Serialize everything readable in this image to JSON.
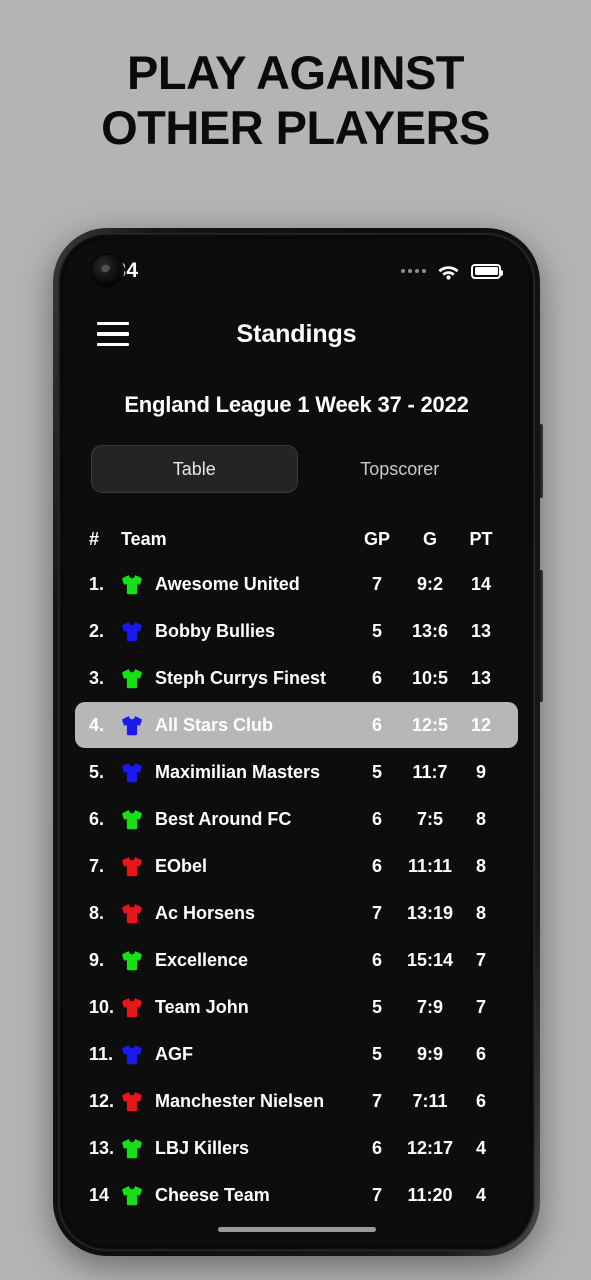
{
  "promo": {
    "headline_lines": [
      "PLAY AGAINST",
      "OTHER PLAYERS"
    ]
  },
  "status_bar": {
    "time": "9.34",
    "signal_icon": "signal-dots-icon",
    "wifi_icon": "wifi-icon",
    "battery_icon": "battery-full-icon"
  },
  "app_bar": {
    "menu_icon": "hamburger-menu-icon",
    "title": "Standings"
  },
  "league": {
    "title": "England League 1 Week 37 - 2022"
  },
  "tabs": [
    {
      "label": "Table",
      "active": true
    },
    {
      "label": "Topscorer",
      "active": false
    }
  ],
  "table": {
    "headers": {
      "rank": "#",
      "team": "Team",
      "gp": "GP",
      "g": "G",
      "pt": "PT"
    },
    "colors": {
      "green": "#16e016",
      "blue": "#1a19f0",
      "red": "#e8151a",
      "highlight_bg": "#b7b7b7",
      "screen_bg": "#0d0d0d",
      "text": "#ffffff"
    },
    "rows": [
      {
        "rank": "1.",
        "shirt": "green",
        "team": "Awesome United",
        "gp": "7",
        "g": "9:2",
        "pt": "14",
        "highlighted": false
      },
      {
        "rank": "2.",
        "shirt": "blue",
        "team": "Bobby Bullies",
        "gp": "5",
        "g": "13:6",
        "pt": "13",
        "highlighted": false
      },
      {
        "rank": "3.",
        "shirt": "green",
        "team": "Steph Currys Finest",
        "gp": "6",
        "g": "10:5",
        "pt": "13",
        "highlighted": false
      },
      {
        "rank": "4.",
        "shirt": "blue",
        "team": "All Stars Club",
        "gp": "6",
        "g": "12:5",
        "pt": "12",
        "highlighted": true
      },
      {
        "rank": "5.",
        "shirt": "blue",
        "team": "Maximilian Masters",
        "gp": "5",
        "g": "11:7",
        "pt": "9",
        "highlighted": false
      },
      {
        "rank": "6.",
        "shirt": "green",
        "team": "Best Around FC",
        "gp": "6",
        "g": "7:5",
        "pt": "8",
        "highlighted": false
      },
      {
        "rank": "7.",
        "shirt": "red",
        "team": "EObel",
        "gp": "6",
        "g": "11:11",
        "pt": "8",
        "highlighted": false
      },
      {
        "rank": "8.",
        "shirt": "red",
        "team": "Ac Horsens",
        "gp": "7",
        "g": "13:19",
        "pt": "8",
        "highlighted": false
      },
      {
        "rank": "9.",
        "shirt": "green",
        "team": "Excellence",
        "gp": "6",
        "g": "15:14",
        "pt": "7",
        "highlighted": false
      },
      {
        "rank": "10.",
        "shirt": "red",
        "team": "Team John",
        "gp": "5",
        "g": "7:9",
        "pt": "7",
        "highlighted": false
      },
      {
        "rank": "11.",
        "shirt": "blue",
        "team": "AGF",
        "gp": "5",
        "g": "9:9",
        "pt": "6",
        "highlighted": false
      },
      {
        "rank": "12.",
        "shirt": "red",
        "team": "Manchester Nielsen",
        "gp": "7",
        "g": "7:11",
        "pt": "6",
        "highlighted": false
      },
      {
        "rank": "13.",
        "shirt": "green",
        "team": "LBJ Killers",
        "gp": "6",
        "g": "12:17",
        "pt": "4",
        "highlighted": false
      },
      {
        "rank": "14",
        "shirt": "green",
        "team": "Cheese Team",
        "gp": "7",
        "g": "11:20",
        "pt": "4",
        "highlighted": false
      }
    ]
  },
  "home_indicator": "home-indicator-bar"
}
